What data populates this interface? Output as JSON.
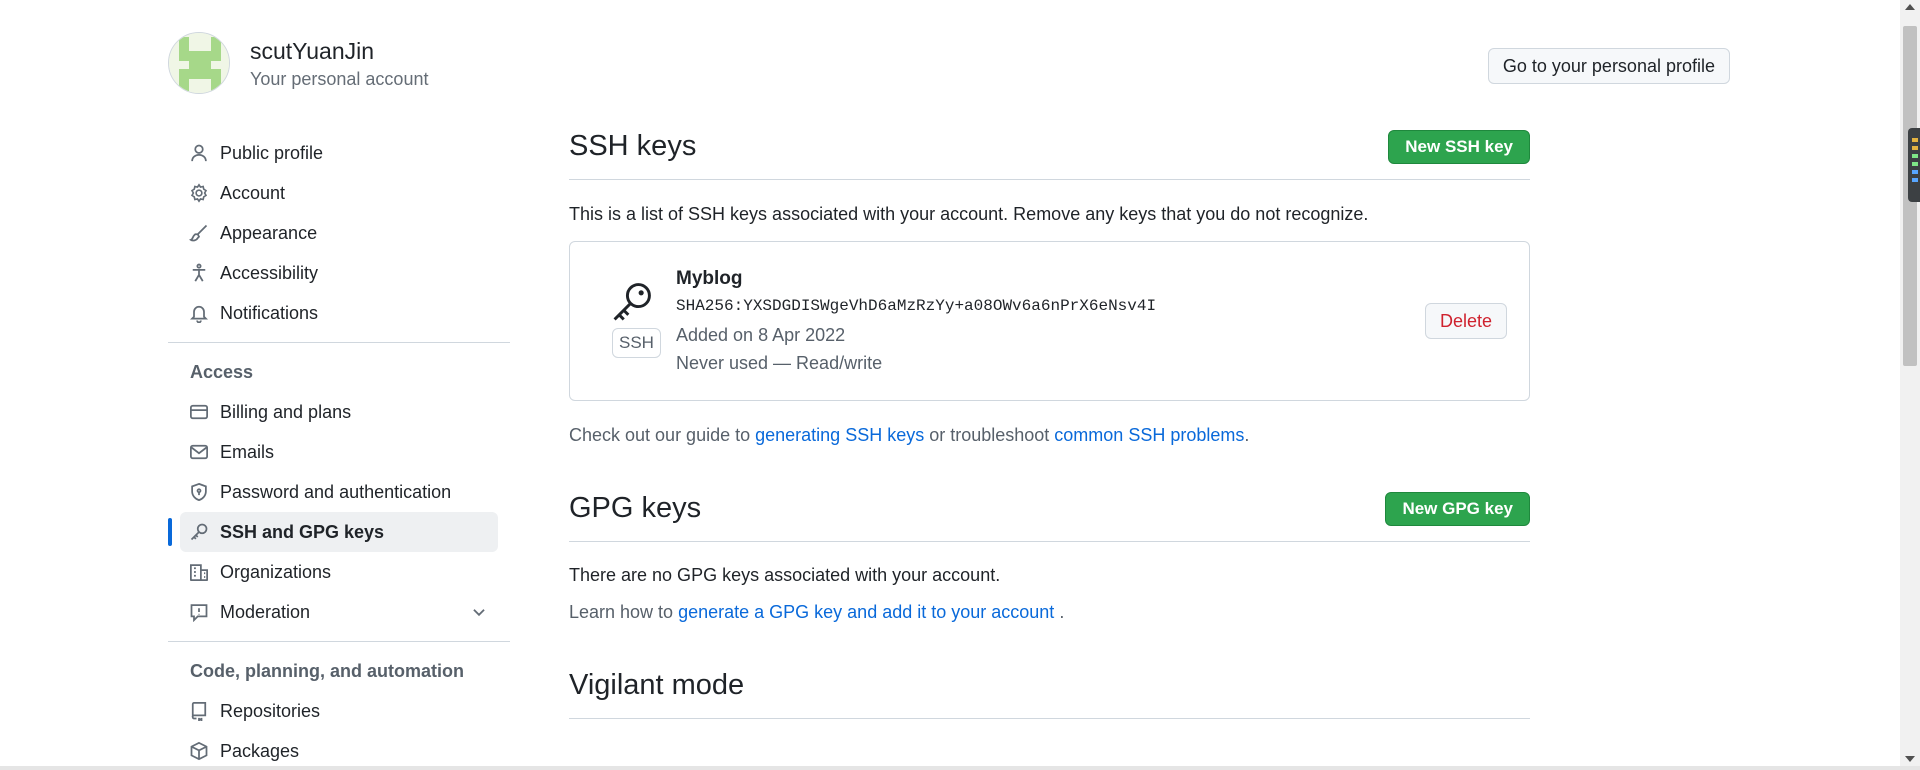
{
  "header": {
    "username": "scutYuanJin",
    "subtitle": "Your personal account",
    "profile_button": "Go to your personal profile"
  },
  "sidebar": {
    "items_top": [
      {
        "label": "Public profile",
        "icon": "person-icon"
      },
      {
        "label": "Account",
        "icon": "gear-icon"
      },
      {
        "label": "Appearance",
        "icon": "paintbrush-icon"
      },
      {
        "label": "Accessibility",
        "icon": "accessibility-icon"
      },
      {
        "label": "Notifications",
        "icon": "bell-icon"
      }
    ],
    "access_heading": "Access",
    "items_access": [
      {
        "label": "Billing and plans",
        "icon": "credit-card-icon"
      },
      {
        "label": "Emails",
        "icon": "mail-icon"
      },
      {
        "label": "Password and authentication",
        "icon": "shield-lock-icon"
      },
      {
        "label": "SSH and GPG keys",
        "icon": "key-icon",
        "active": true
      },
      {
        "label": "Organizations",
        "icon": "organization-icon"
      },
      {
        "label": "Moderation",
        "icon": "report-icon"
      }
    ],
    "code_heading": "Code, planning, and automation",
    "items_code": [
      {
        "label": "Repositories",
        "icon": "repo-icon"
      },
      {
        "label": "Packages",
        "icon": "package-icon"
      }
    ]
  },
  "ssh": {
    "title": "SSH keys",
    "new_button": "New SSH key",
    "description": "This is a list of SSH keys associated with your account. Remove any keys that you do not recognize.",
    "key": {
      "badge": "SSH",
      "name": "Myblog",
      "fingerprint": "SHA256:YXSDGDISWgeVhD6aMzRzYy+a08OWv6a6nPrX6eNsv4I",
      "added": "Added on 8 Apr 2022",
      "usage": "Never used — Read/write",
      "delete_button": "Delete"
    },
    "guide_prefix": "Check out our guide to ",
    "guide_link1": "generating SSH keys",
    "guide_middle": " or troubleshoot ",
    "guide_link2": "common SSH problems",
    "guide_suffix": "."
  },
  "gpg": {
    "title": "GPG keys",
    "new_button": "New GPG key",
    "empty_text": "There are no GPG keys associated with your account.",
    "learn_prefix": "Learn how to ",
    "learn_link": "generate a GPG key and add it to your account",
    "learn_suffix": " ."
  },
  "vigilant": {
    "title": "Vigilant mode"
  },
  "colors": {
    "accent_blue": "#0969da",
    "green_button": "#2da44e",
    "danger_red": "#cf222e",
    "border": "#d0d7de"
  }
}
